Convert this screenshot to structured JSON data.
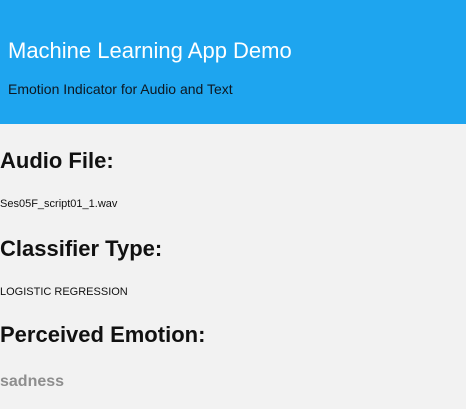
{
  "header": {
    "title": "Machine Learning App Demo",
    "subtitle": "Emotion Indicator for Audio and Text",
    "background_color": "#1ea5ef"
  },
  "audio": {
    "heading": "Audio File:",
    "value": "Ses05F_script01_1.wav"
  },
  "classifier": {
    "heading": "Classifier Type:",
    "value": "LOGISTIC REGRESSION"
  },
  "emotion": {
    "heading": "Perceived Emotion:",
    "value": "sadness",
    "value_color": "#8e8e8e"
  }
}
